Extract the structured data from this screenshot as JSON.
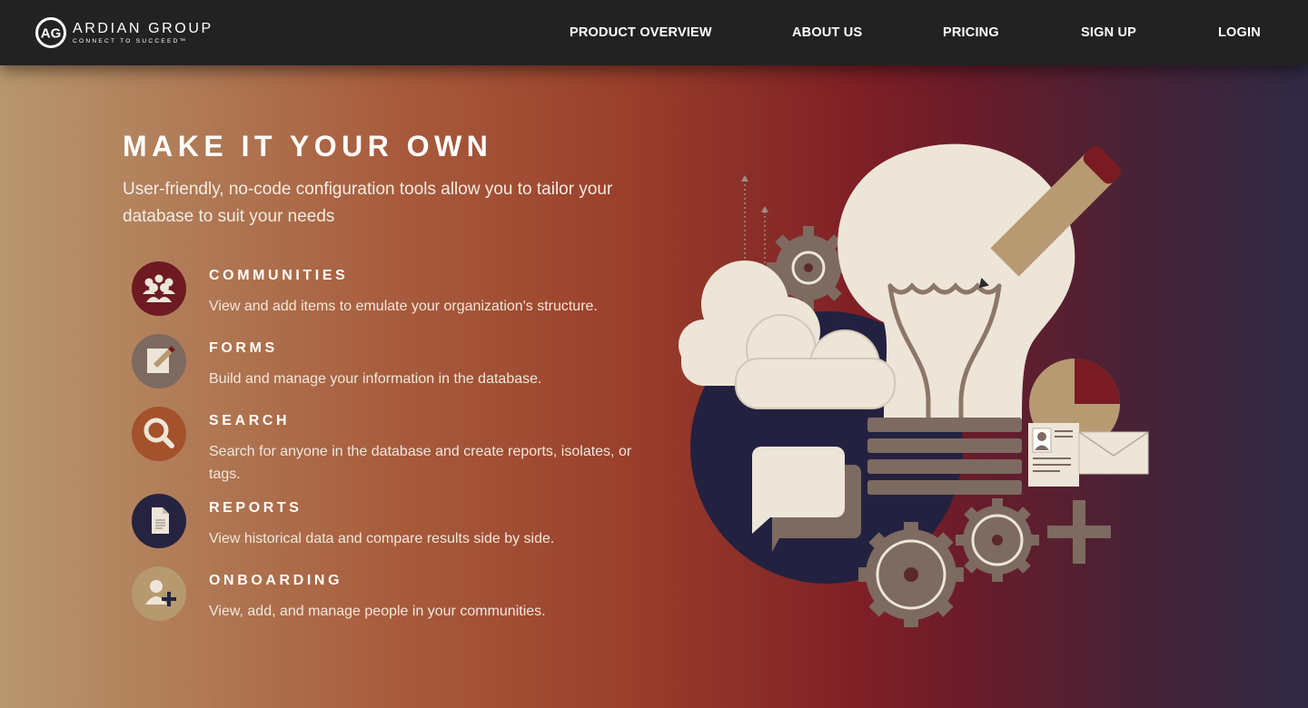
{
  "brand": {
    "name": "ARDIAN GROUP",
    "tagline": "CONNECT TO SUCCEED™",
    "logo_initials": "AG"
  },
  "nav": {
    "items": [
      {
        "label": "PRODUCT OVERVIEW"
      },
      {
        "label": "ABOUT US"
      },
      {
        "label": "PRICING"
      },
      {
        "label": "SIGN UP"
      },
      {
        "label": "LOGIN"
      }
    ]
  },
  "hero": {
    "title": "MAKE IT YOUR OWN",
    "subtitle": "User-friendly, no-code configuration tools allow you to tailor your database to suit your needs"
  },
  "features": [
    {
      "title": "COMMUNITIES",
      "description": "View and add items to emulate your organization's structure.",
      "icon": "people-group-icon",
      "color": "#6e1a22"
    },
    {
      "title": "FORMS",
      "description": "Build and manage your information in the database.",
      "icon": "form-pencil-icon",
      "color": "#7d6a60"
    },
    {
      "title": "SEARCH",
      "description": "Search for anyone in the database and create reports, isolates, or tags.",
      "icon": "magnifier-icon",
      "color": "#a4522c"
    },
    {
      "title": "REPORTS",
      "description": "View historical data and compare results side by side.",
      "icon": "document-icon",
      "color": "#252340"
    },
    {
      "title": "ONBOARDING",
      "description": "View, add, and manage people in your communities.",
      "icon": "add-person-icon",
      "color": "#b7996e"
    }
  ],
  "colors": {
    "topbar": "#222222",
    "cream": "#ede5d8",
    "taupe": "#7d6a60",
    "tan": "#b89a72",
    "maroon": "#7a1a22",
    "navy": "#232140"
  }
}
